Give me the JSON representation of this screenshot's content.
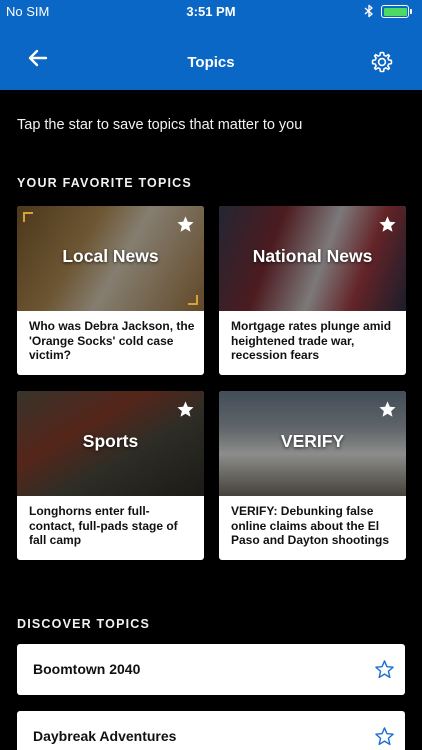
{
  "status_bar": {
    "carrier": "No SIM",
    "time": "3:51 PM",
    "battery_level": 1.0,
    "battery_color": "#4cd964"
  },
  "nav": {
    "title": "Topics",
    "back_icon": "arrow-left-icon",
    "settings_icon": "gear-icon",
    "background_color": "#0b67c5"
  },
  "intro_text": "Tap the star to save topics that matter to you",
  "favorites": {
    "section_title": "YOUR FAVORITE TOPICS",
    "cards": [
      {
        "topic": "Local News",
        "headline": "Who was Debra Jackson, the 'Orange Socks' cold case victim?",
        "starred": true
      },
      {
        "topic": "National News",
        "headline": "Mortgage rates plunge amid heightened trade war, recession fears",
        "starred": true
      },
      {
        "topic": "Sports",
        "headline": "Longhorns enter full-contact, full-pads stage of fall camp",
        "starred": true
      },
      {
        "topic": "VERIFY",
        "headline": "VERIFY: Debunking false online claims about the El Paso and Dayton shootings",
        "starred": true
      }
    ]
  },
  "discover": {
    "section_title": "DISCOVER TOPICS",
    "items": [
      {
        "label": "Boomtown 2040",
        "starred": false
      },
      {
        "label": "Daybreak Adventures",
        "starred": false
      }
    ],
    "star_color": "#1a6fd1"
  }
}
